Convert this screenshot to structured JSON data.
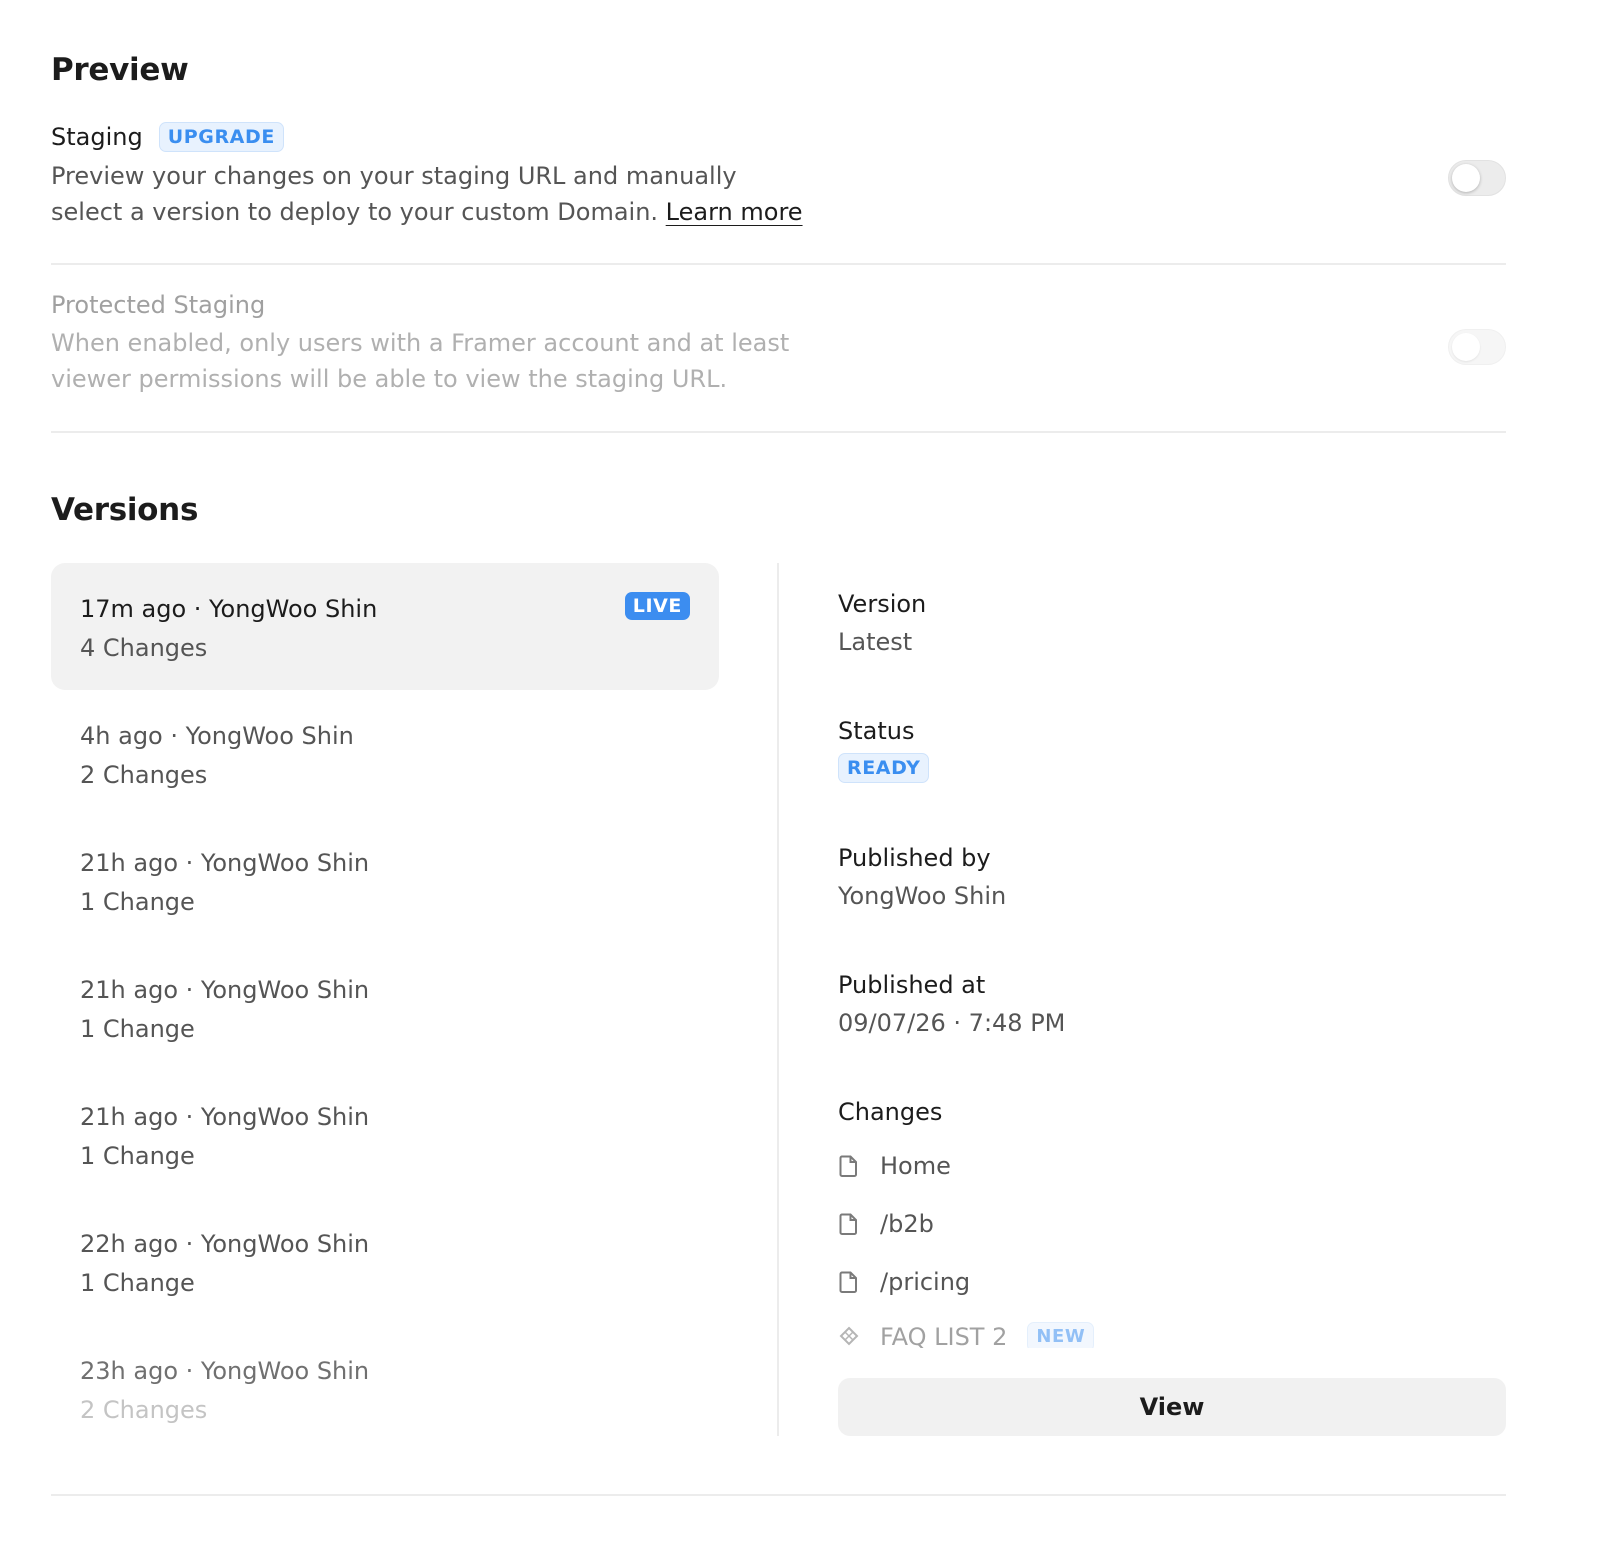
{
  "preview": {
    "title": "Preview",
    "staging": {
      "label": "Staging",
      "badge": "UPGRADE",
      "desc_line1": "Preview your changes on your staging URL and manually",
      "desc_line2": "select a version to deploy to your custom Domain.",
      "learn_more": "Learn more",
      "enabled": false
    },
    "protected": {
      "label": "Protected Staging",
      "desc_line1": "When enabled, only users with a Framer account and at least",
      "desc_line2": "viewer permissions will be able to view the staging URL.",
      "enabled": false
    }
  },
  "versions": {
    "title": "Versions",
    "items": [
      {
        "title": "17m ago · YongWoo Shin",
        "changes": "4 Changes",
        "badge": "LIVE",
        "selected": true
      },
      {
        "title": "4h ago · YongWoo Shin",
        "changes": "2 Changes"
      },
      {
        "title": "21h ago · YongWoo Shin",
        "changes": "1 Change"
      },
      {
        "title": "21h ago · YongWoo Shin",
        "changes": "1 Change"
      },
      {
        "title": "21h ago · YongWoo Shin",
        "changes": "1 Change"
      },
      {
        "title": "22h ago · YongWoo Shin",
        "changes": "1 Change"
      },
      {
        "title": "23h ago · YongWoo Shin",
        "changes": "2 Changes"
      }
    ]
  },
  "details": {
    "version_label": "Version",
    "version_value": "Latest",
    "status_label": "Status",
    "status_value": "READY",
    "published_by_label": "Published by",
    "published_by_value": "YongWoo Shin",
    "published_at_label": "Published at",
    "published_at_value": "09/07/26 · 7:48 PM",
    "changes_label": "Changes",
    "changes": [
      {
        "icon": "page-icon",
        "name": "Home"
      },
      {
        "icon": "page-icon",
        "name": "/b2b"
      },
      {
        "icon": "page-icon",
        "name": "/pricing"
      },
      {
        "icon": "component-icon",
        "name": "FAQ LIST 2",
        "badge": "NEW"
      }
    ],
    "view_button": "View"
  },
  "colors": {
    "accent": "#3c8df0",
    "badge_bg": "#e8f2fe",
    "selected_bg": "#f2f2f2"
  }
}
